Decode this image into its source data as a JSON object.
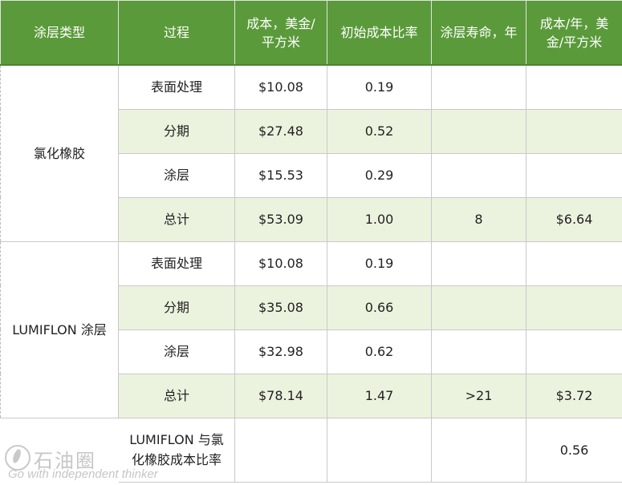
{
  "header": {
    "coating_type": "涂层类型",
    "process": "过程",
    "cost": "成本，美金/平方米",
    "initial_ratio": "初始成本比率",
    "lifetime": "涂层寿命，年",
    "cost_per_year": "成本/年，美金/平方米"
  },
  "groups": [
    {
      "name": "氯化橡胶",
      "rows": [
        {
          "process": "表面处理",
          "cost": "$10.08",
          "ratio": "0.19",
          "life": "",
          "per_year": ""
        },
        {
          "process": "分期",
          "cost": "$27.48",
          "ratio": "0.52",
          "life": "",
          "per_year": ""
        },
        {
          "process": "涂层",
          "cost": "$15.53",
          "ratio": "0.29",
          "life": "",
          "per_year": ""
        },
        {
          "process": "总计",
          "cost": "$53.09",
          "ratio": "1.00",
          "life": "8",
          "per_year": "$6.64"
        }
      ]
    },
    {
      "name": "LUMIFLON 涂层",
      "rows": [
        {
          "process": "表面处理",
          "cost": "$10.08",
          "ratio": "0.19",
          "life": "",
          "per_year": ""
        },
        {
          "process": "分期",
          "cost": "$35.08",
          "ratio": "0.66",
          "life": "",
          "per_year": ""
        },
        {
          "process": "涂层",
          "cost": "$32.98",
          "ratio": "0.62",
          "life": "",
          "per_year": ""
        },
        {
          "process": "总计",
          "cost": "$78.14",
          "ratio": "1.47",
          "life": ">21",
          "per_year": "$3.72"
        }
      ]
    }
  ],
  "ratio_row": {
    "label": "LUMIFLON 与氯化橡胶成本比率",
    "value": "0.56"
  },
  "watermark": {
    "brand": "石油圈",
    "tagline": "Go with independent thinker"
  },
  "colors": {
    "header_bg": "#5a9a3a",
    "shaded_row": "#ebf3df"
  }
}
